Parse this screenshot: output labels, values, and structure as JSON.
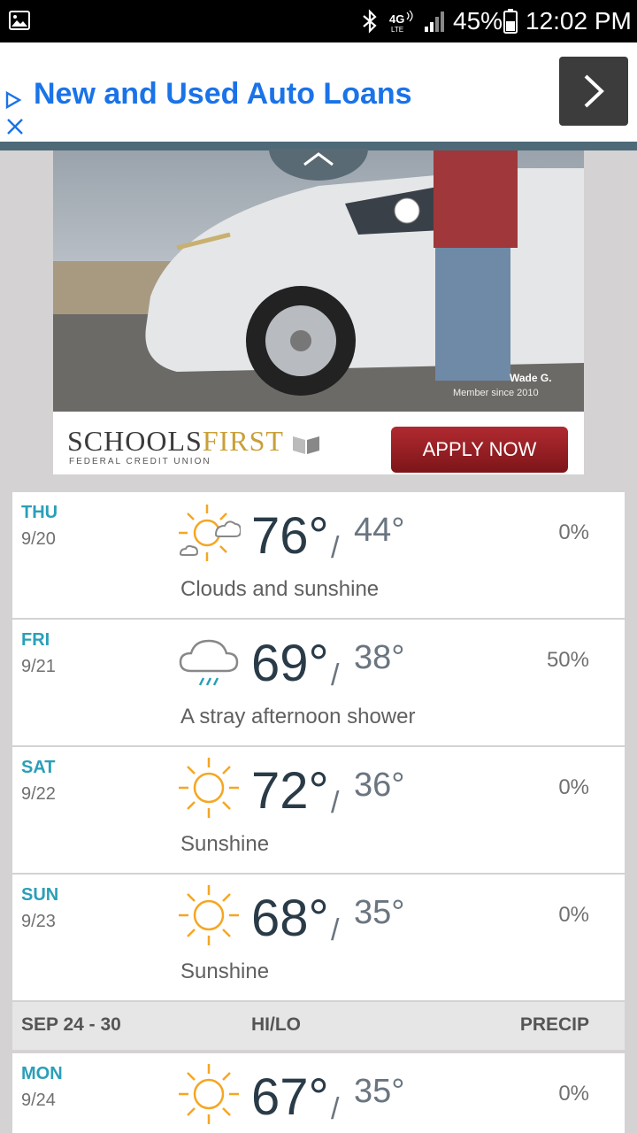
{
  "status_bar": {
    "battery": "45%",
    "time": "12:02 PM",
    "network": "4G LTE"
  },
  "ad_banner": {
    "headline": "New and Used Auto Loans"
  },
  "ad_image": {
    "caption_name": "Wade G.",
    "caption_member": "Member since 2010",
    "brand": "SCHOOLS",
    "brand_accent": "FIRST",
    "brand_sub": "FEDERAL CREDIT UNION",
    "cta": "APPLY NOW"
  },
  "forecast": [
    {
      "day": "THU",
      "date": "9/20",
      "hi": "76°",
      "lo": "44°",
      "precip": "0%",
      "desc": "Clouds and sunshine",
      "icon": "partly-sunny-icon"
    },
    {
      "day": "FRI",
      "date": "9/21",
      "hi": "69°",
      "lo": "38°",
      "precip": "50%",
      "desc": "A stray afternoon shower",
      "icon": "rain-cloud-icon"
    },
    {
      "day": "SAT",
      "date": "9/22",
      "hi": "72°",
      "lo": "36°",
      "precip": "0%",
      "desc": "Sunshine",
      "icon": "sun-icon"
    },
    {
      "day": "SUN",
      "date": "9/23",
      "hi": "68°",
      "lo": "35°",
      "precip": "0%",
      "desc": "Sunshine",
      "icon": "sun-icon"
    }
  ],
  "week_header": {
    "range": "SEP 24 - 30",
    "hilo": "HI/LO",
    "precip": "PRECIP"
  },
  "next_week": [
    {
      "day": "MON",
      "date": "9/24",
      "hi": "67°",
      "lo": "35°",
      "precip": "0%",
      "icon": "sun-icon"
    }
  ],
  "colors": {
    "day_label": "#2a9fb8",
    "temp_hi": "#2a3b48",
    "ad_link": "#1a73e8",
    "sun": "#f5a623"
  }
}
